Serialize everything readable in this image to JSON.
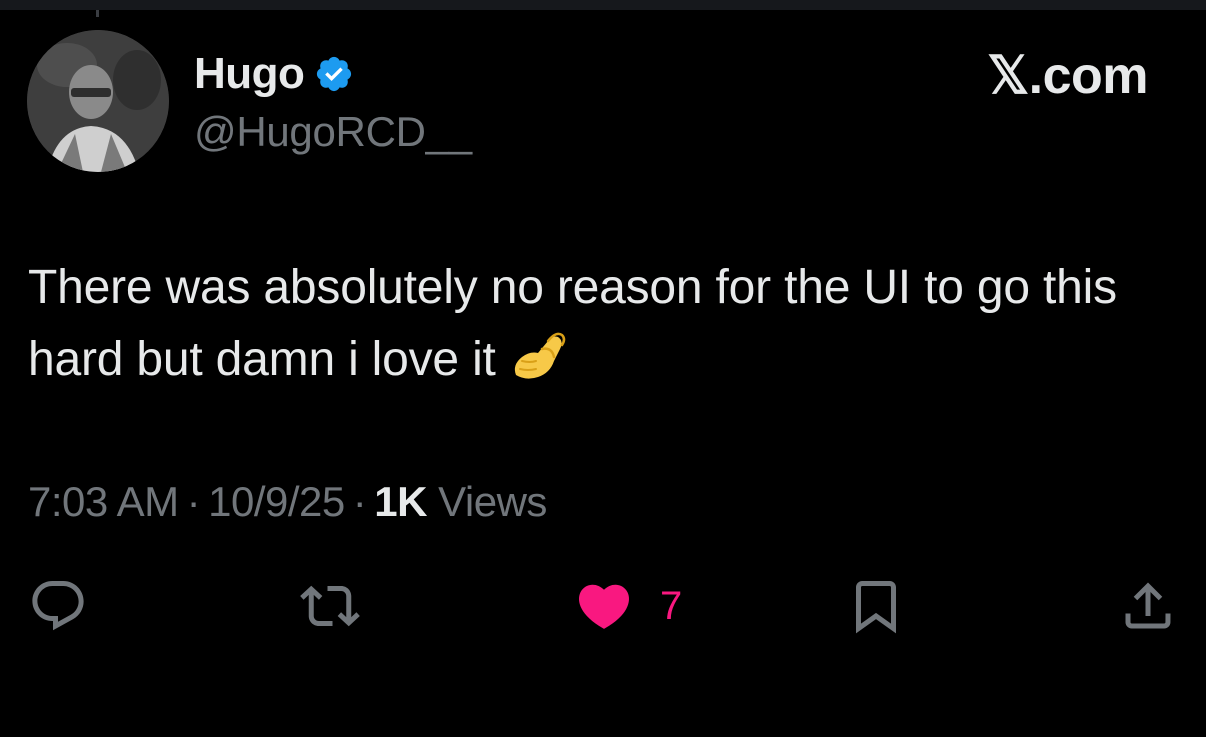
{
  "colors": {
    "background": "#000000",
    "text_primary": "#e7e9ea",
    "text_secondary": "#71767b",
    "verified_blue": "#1d9bf0",
    "like_pink": "#f91880"
  },
  "author": {
    "display_name": "Hugo",
    "handle": "@HugoRCD__",
    "verified": true,
    "avatar_icon": "profile-photo"
  },
  "brand": {
    "label": "𝕏.com"
  },
  "tweet": {
    "text": "There was absolutely no reason for the UI to go this hard but damn i love it",
    "emoji": "pinched-fingers-emoji"
  },
  "meta": {
    "time": "7:03 AM",
    "separator": "·",
    "date": "10/9/25",
    "views_count": "1K",
    "views_label": "Views"
  },
  "actions": {
    "reply_icon": "reply-icon",
    "retweet_icon": "retweet-icon",
    "like_icon": "heart-filled-icon",
    "like_count": "7",
    "liked": true,
    "bookmark_icon": "bookmark-icon",
    "share_icon": "share-icon"
  }
}
